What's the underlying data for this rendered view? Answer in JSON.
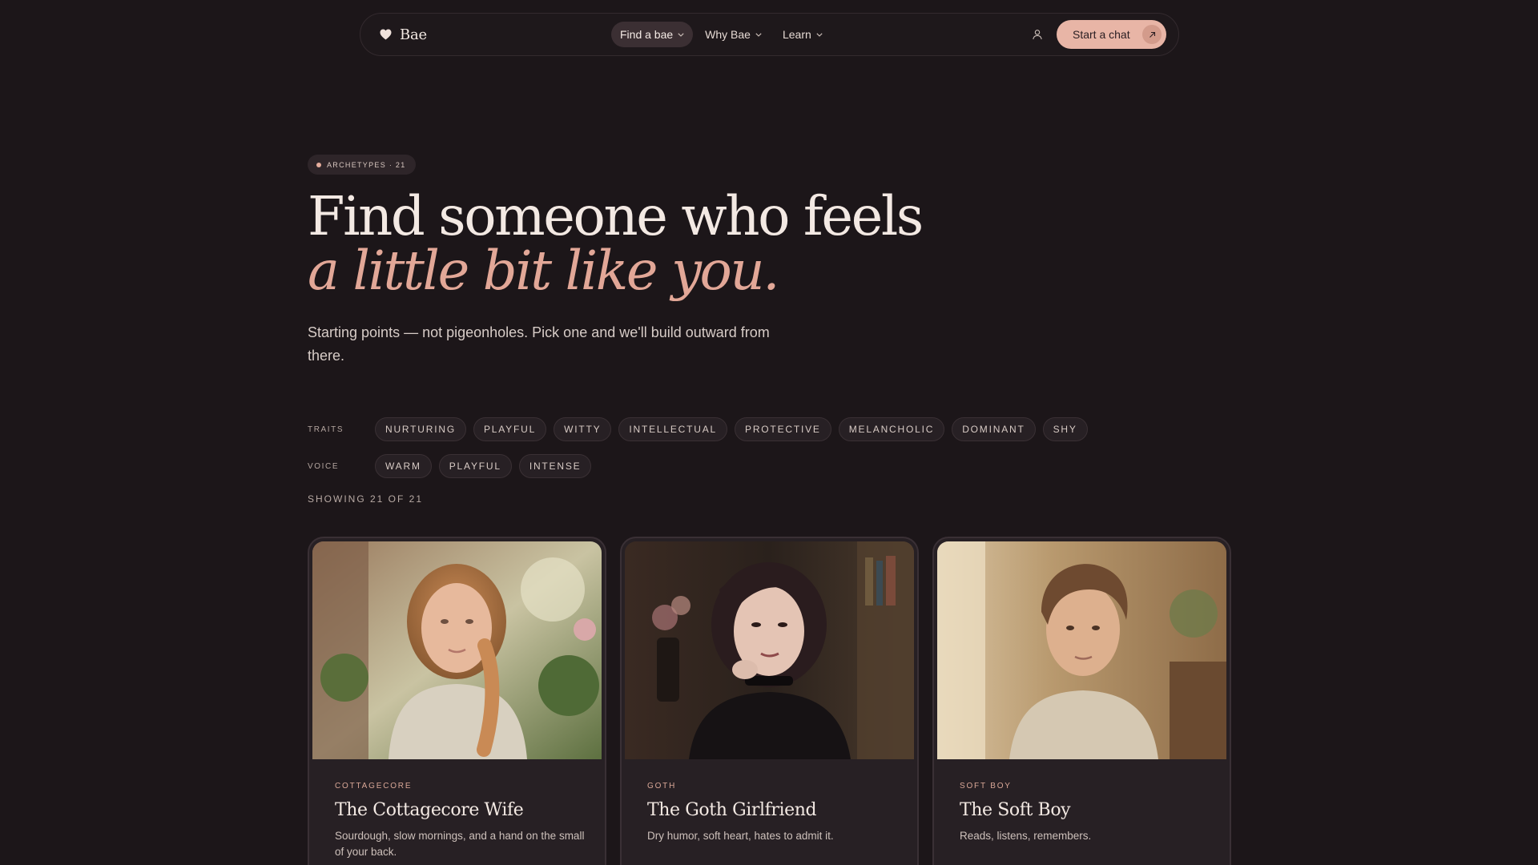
{
  "brand": {
    "name": "Bae",
    "icon": "heart-icon"
  },
  "nav": {
    "items": [
      {
        "label": "Find a bae",
        "active": true
      },
      {
        "label": "Why Bae",
        "active": false
      },
      {
        "label": "Learn",
        "active": false
      }
    ],
    "user_icon": "user-icon",
    "cta_label": "Start a chat",
    "cta_icon": "arrow-up-right-icon"
  },
  "hero": {
    "badge": "ARCHETYPES · 21",
    "title_line1": "Find someone who feels",
    "title_line2": "a little bit like you.",
    "subtitle": "Starting points — not pigeonholes. Pick one and we'll build outward from there."
  },
  "filters": {
    "traits_label": "TRAITS",
    "traits": [
      "NURTURING",
      "PLAYFUL",
      "WITTY",
      "INTELLECTUAL",
      "PROTECTIVE",
      "MELANCHOLIC",
      "DOMINANT",
      "SHY"
    ],
    "voice_label": "VOICE",
    "voice": [
      "WARM",
      "PLAYFUL",
      "INTENSE"
    ],
    "showing": "SHOWING 21 OF 21"
  },
  "cards": [
    {
      "tag": "COTTAGECORE",
      "name": "The Cottagecore Wife",
      "desc": "Sourdough, slow mornings, and a hand on the small of your back."
    },
    {
      "tag": "GOTH",
      "name": "The Goth Girlfriend",
      "desc": "Dry humor, soft heart, hates to admit it."
    },
    {
      "tag": "SOFT BOY",
      "name": "The Soft Boy",
      "desc": "Reads, listens, remembers."
    }
  ],
  "colors": {
    "background": "#1c1619",
    "accent": "#e8b5a6",
    "accent_text": "#e2a797"
  }
}
